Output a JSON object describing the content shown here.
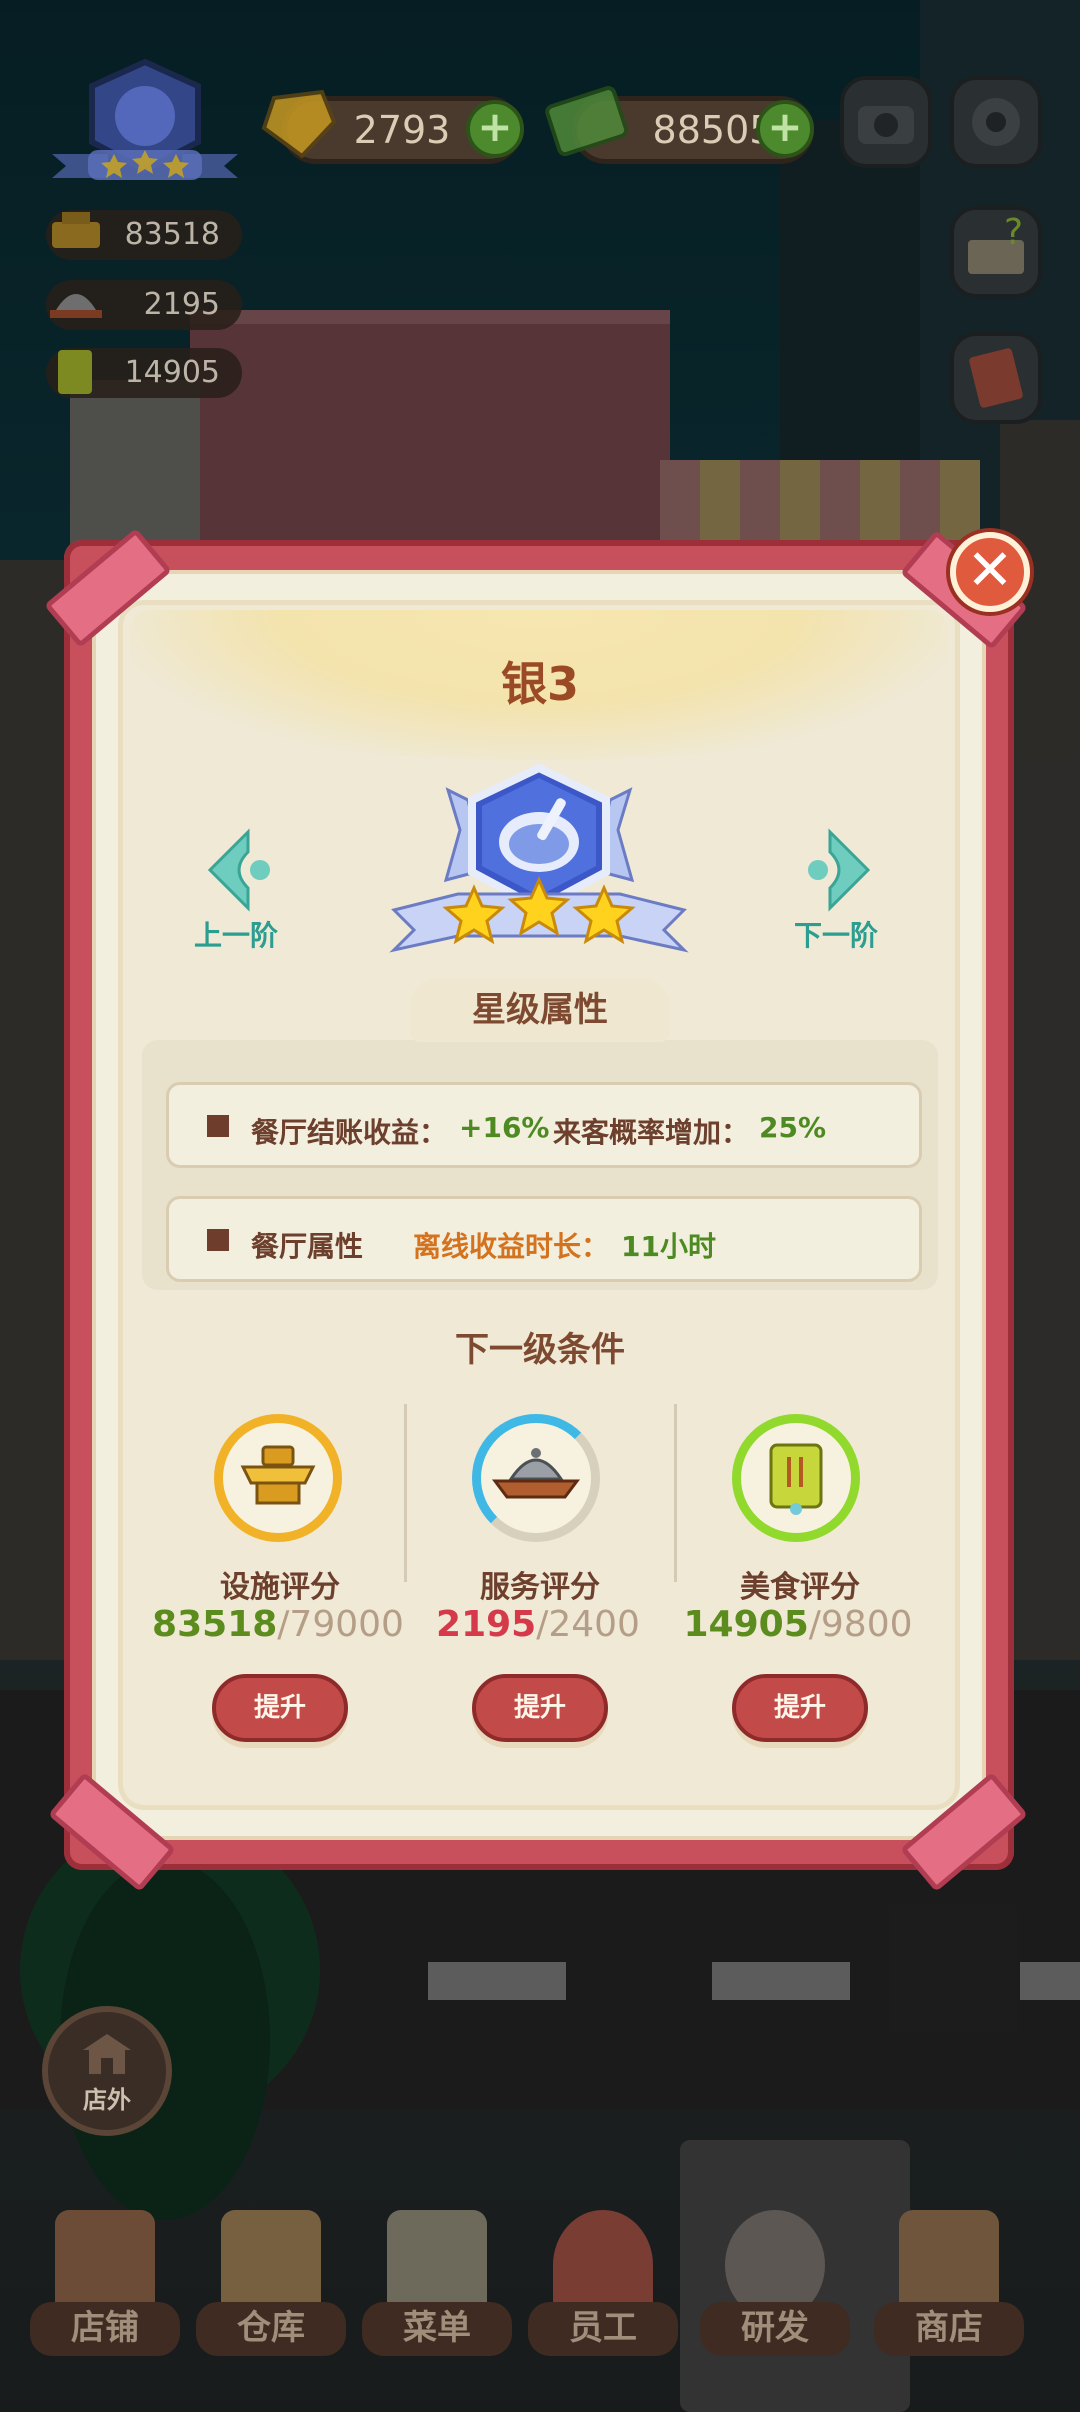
{
  "hud": {
    "gems": "2793",
    "cash": "88505",
    "facility_score": "83518",
    "service_score": "2195",
    "food_score": "14905",
    "plus": "+"
  },
  "modal": {
    "title": "银3",
    "close": "✕",
    "prev_label": "上一阶",
    "next_label": "下一阶",
    "section_title": "星级属性",
    "attr_row1_label": "餐厅结账收益：",
    "attr_row1_value": "+16%",
    "attr_row1_label2": "来客概率增加：",
    "attr_row1_value2": "25%",
    "attr_row2_label": "餐厅属性",
    "attr_row2_label2": "离线收益时长：",
    "attr_row2_value": "11小时",
    "next_level_title": "下一级条件",
    "requirements": [
      {
        "label": "设施评分",
        "current": "83518",
        "sep_target": "/79000",
        "button": "提升"
      },
      {
        "label": "服务评分",
        "current": "2195",
        "sep_target": "/2400",
        "button": "提升"
      },
      {
        "label": "美食评分",
        "current": "14905",
        "sep_target": "/9800",
        "button": "提升"
      }
    ]
  },
  "outside_label": "店外",
  "tabs": [
    "店铺",
    "仓库",
    "菜单",
    "员工",
    "研发",
    "商店"
  ],
  "colors": {
    "accent_frame": "#c8505c",
    "title": "#9b4a26",
    "ok": "#5c8c1d",
    "not_ok": "#d53a4b"
  },
  "icons": [
    "rank-badge-icon",
    "gem-icon",
    "cash-icon",
    "camera-icon",
    "gear-icon",
    "guide-book-icon",
    "recipe-book-icon",
    "close-icon",
    "prev-arrow-icon",
    "next-arrow-icon",
    "facility-icon",
    "service-icon",
    "food-icon",
    "shop-icon"
  ]
}
